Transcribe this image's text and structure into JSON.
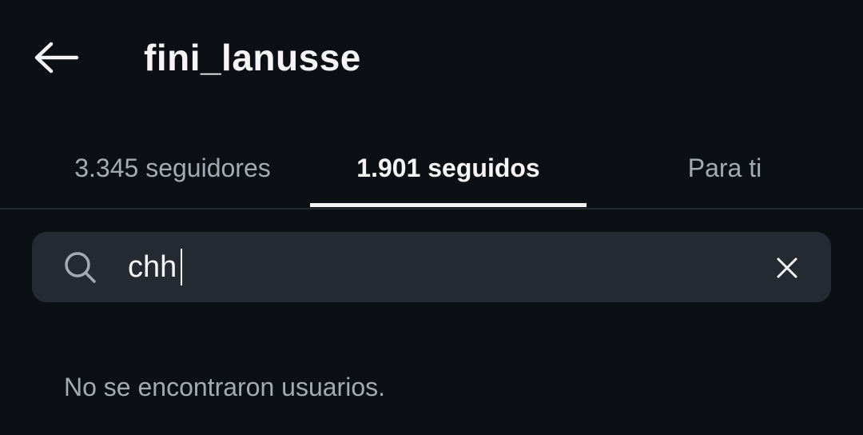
{
  "header": {
    "title": "fini_lanusse",
    "back_icon": "arrow-left-icon"
  },
  "tabs": [
    {
      "label": "3.345 seguidores",
      "active": false
    },
    {
      "label": "1.901 seguidos",
      "active": true
    },
    {
      "label": "Para ti",
      "active": false
    }
  ],
  "search": {
    "value": "chh",
    "icon": "search-icon",
    "clear_icon": "close-icon"
  },
  "results": {
    "empty_message": "No se encontraron usuarios."
  },
  "colors": {
    "background": "#0c0f14",
    "text_primary": "#f5f5f5",
    "text_secondary": "#a6abb3",
    "search_background": "#262a33"
  }
}
